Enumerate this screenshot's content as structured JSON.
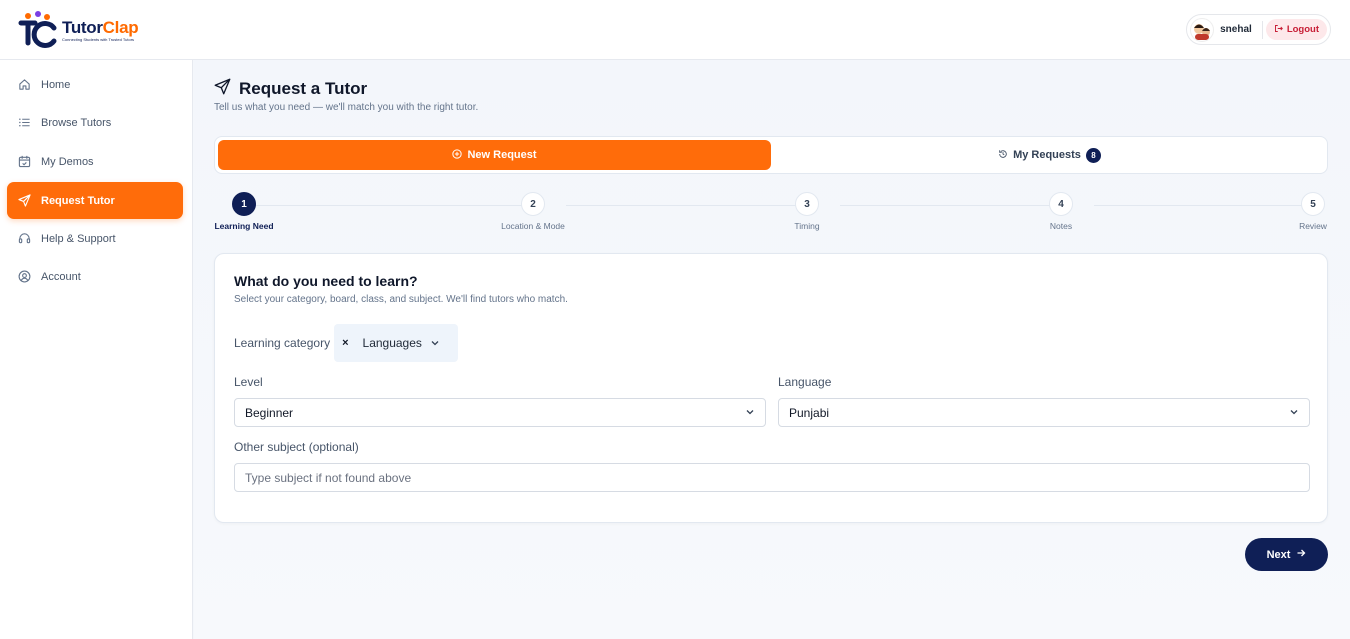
{
  "brand": {
    "name_part1": "Tutor",
    "name_part2": "Clap",
    "tagline": "Connecting Students with Trusted Tutors"
  },
  "header": {
    "user_name": "snehal",
    "logout_label": "Logout"
  },
  "sidebar": {
    "items": [
      {
        "label": "Home",
        "icon": "home-icon"
      },
      {
        "label": "Browse Tutors",
        "icon": "list-icon"
      },
      {
        "label": "My Demos",
        "icon": "calendar-icon"
      },
      {
        "label": "Request Tutor",
        "icon": "send-icon",
        "active": true
      },
      {
        "label": "Help & Support",
        "icon": "headset-icon"
      },
      {
        "label": "Account",
        "icon": "user-circle-icon"
      }
    ]
  },
  "page": {
    "title": "Request a Tutor",
    "subtitle": "Tell us what you need — we'll match you with the right tutor."
  },
  "tabs": {
    "new_request": "New Request",
    "my_requests": "My Requests",
    "my_requests_count": "8"
  },
  "stepper": {
    "steps": [
      {
        "number": "1",
        "label": "Learning Need",
        "active": true
      },
      {
        "number": "2",
        "label": "Location & Mode"
      },
      {
        "number": "3",
        "label": "Timing"
      },
      {
        "number": "4",
        "label": "Notes"
      },
      {
        "number": "5",
        "label": "Review"
      }
    ]
  },
  "form": {
    "title": "What do you need to learn?",
    "subtitle": "Select your category, board, class, and subject. We'll find tutors who match.",
    "category_label": "Learning category",
    "category_clear": "×",
    "category_value": "Languages",
    "level_label": "Level",
    "level_value": "Beginner",
    "language_label": "Language",
    "language_value": "Punjabi",
    "other_label": "Other subject (optional)",
    "other_placeholder": "Type subject if not found above",
    "other_value": ""
  },
  "actions": {
    "next_label": "Next"
  },
  "colors": {
    "accent": "#ff6c0a",
    "navy": "#0f1f56",
    "logout_bg": "#fde8ea",
    "logout_text": "#c81e36"
  }
}
